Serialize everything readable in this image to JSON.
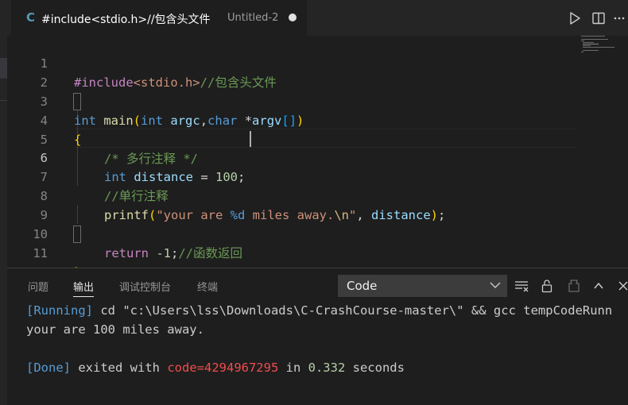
{
  "tab": {
    "language_badge": "C",
    "title": "#include<stdio.h>//包含头文件",
    "description": "Untitled-2",
    "dirty": true
  },
  "editor": {
    "line_numbers": [
      "1",
      "2",
      "3",
      "4",
      "5",
      "6",
      "7",
      "8",
      "9",
      "10",
      "11"
    ],
    "active_line": 6,
    "lines": {
      "l1": {
        "include": "#include",
        "header": "<stdio.h>",
        "comment": "//包含头文件"
      },
      "l3": {
        "ret_type": "int",
        "func": "main",
        "lparen": "(",
        "t1": "int",
        "p1": "argc",
        "comma": ",",
        "t2": "char",
        "star": " *",
        "p2": "argv",
        "brackets": "[]",
        "rparen": ")"
      },
      "l4": {
        "brace": "{"
      },
      "l5": {
        "comment": "/* 多行注释 */"
      },
      "l6": {
        "type": "int",
        "var": "distance",
        "op": " = ",
        "num": "100",
        "semi": ";"
      },
      "l7": {
        "comment": "//单行注释"
      },
      "l8": {
        "func": "printf",
        "lparen": "(",
        "str_a": "\"your are ",
        "fmt": "%d",
        "str_b": " miles away.",
        "esc": "\\n",
        "str_c": "\"",
        "comma": ", ",
        "var": "distance",
        "rparen": ")",
        "semi": ";"
      },
      "l10": {
        "kw": "return",
        "num": " -1",
        "semi": ";",
        "comment": "//函数返回"
      },
      "l11": {
        "brace": "}"
      }
    }
  },
  "panel": {
    "tabs": [
      "问题",
      "输出",
      "调试控制台",
      "终端"
    ],
    "active_tab": "输出",
    "channel": "Code",
    "output": {
      "line1": {
        "tag": "[Running]",
        "cmd": " cd \"c:\\Users\\lss\\Downloads\\C-CrashCourse-master\\\" && gcc tempCodeRunn"
      },
      "line2": {
        "text": "your are 100 miles away."
      },
      "line4": {
        "tag": "[Done]",
        "mid": " exited with ",
        "code": "code=4294967295",
        "in": " in ",
        "secs": "0.332",
        "tail": " seconds"
      }
    }
  },
  "icons": [
    "run-icon",
    "split-editor-icon",
    "more-actions-icon",
    "clear-output-icon",
    "lock-scroll-icon",
    "open-log-icon",
    "maximize-panel-icon",
    "close-panel-icon",
    "chevron-down-icon"
  ],
  "colors": {
    "keyword": "#569cd6",
    "string": "#ce9178",
    "comment": "#6a9955",
    "function": "#dcdcaa",
    "variable": "#9cdcfe",
    "number": "#b5cea8",
    "preprocessor": "#c586c0",
    "error_red": "#f14c4c"
  }
}
